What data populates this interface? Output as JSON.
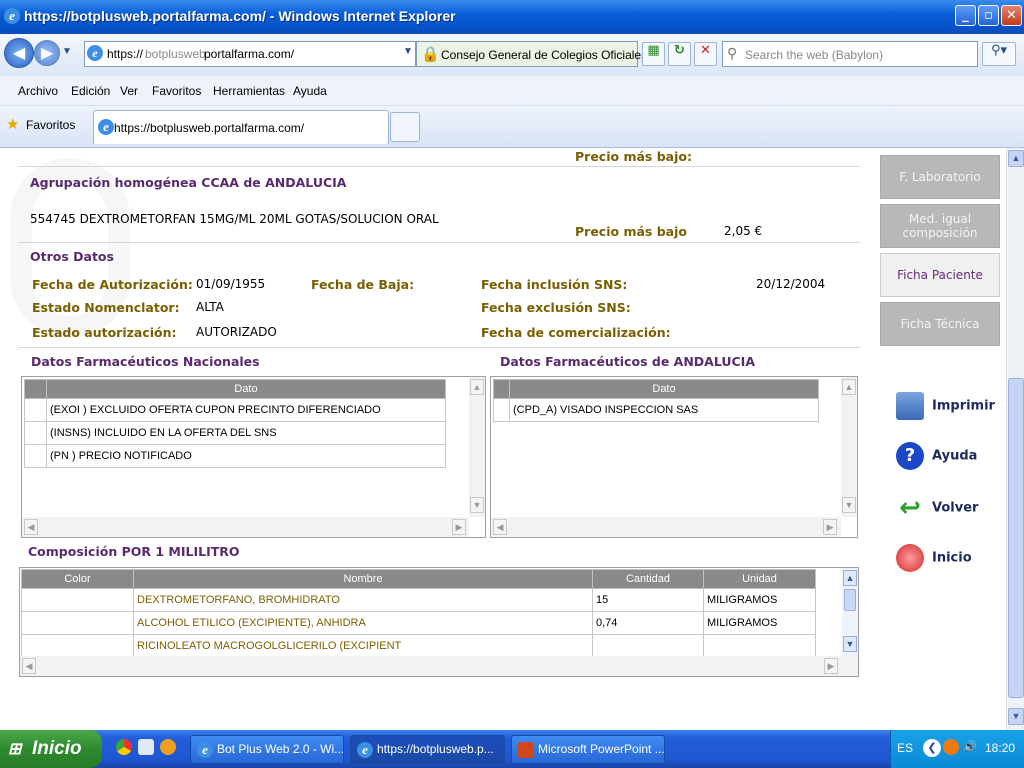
{
  "window": {
    "title": "https://botplusweb.portalfarma.com/ - Windows Internet Explorer",
    "minimize": "_",
    "maximize": "▫",
    "close": "✕"
  },
  "address_bar": {
    "prefix": "https://",
    "sub": "botplusweb.",
    "domain": "portalfarma.com/",
    "security_label": "Consejo General de Colegios Oficiales ...",
    "search_placeholder": "Search the web (Babylon)"
  },
  "menu": [
    "Archivo",
    "Edición",
    "Ver",
    "Favoritos",
    "Herramientas",
    "Ayuda"
  ],
  "favorites": {
    "label": "Favoritos",
    "tab_title": "https://botplusweb.portalfarma.com/"
  },
  "page": {
    "top_price_label": "Precio más bajo:",
    "agrupacion_title": "Agrupación homogénea CCAA de ANDALUCIA",
    "product_line": "554745  DEXTROMETORFAN 15MG/ML 20ML GOTAS/SOLUCION ORAL",
    "price_label": "Precio más bajo",
    "price_value": "2,05 €",
    "otros_title": "Otros Datos",
    "fecha_autorizacion_label": "Fecha de Autorización:",
    "fecha_autorizacion_value": "01/09/1955",
    "fecha_baja_label": "Fecha de Baja:",
    "fecha_inclusion_label": "Fecha inclusión SNS:",
    "fecha_inclusion_value": "20/12/2004",
    "estado_nomenclator_label": "Estado Nomenclator:",
    "estado_nomenclator_value": "ALTA",
    "fecha_exclusion_label": "Fecha exclusión SNS:",
    "estado_autorizacion_label": "Estado autorización:",
    "estado_autorizacion_value": "AUTORIZADO",
    "fecha_comercializacion_label": "Fecha de comercialización:",
    "nacionales_title": "Datos Farmacéuticos Nacionales",
    "andalucia_title": "Datos Farmacéuticos de ANDALUCIA",
    "dato_header": "Dato",
    "nacionales_rows": [
      "(EXOI ) EXCLUIDO OFERTA CUPON PRECINTO DIFERENCIADO",
      "(INSNS) INCLUIDO EN LA OFERTA DEL SNS",
      "(PN ) PRECIO NOTIFICADO"
    ],
    "andalucia_rows": [
      "(CPD_A) VISADO INSPECCION SAS"
    ],
    "composicion_title": "Composición POR 1 MILILITRO",
    "composicion_headers": [
      "Color",
      "Nombre",
      "Cantidad",
      "Unidad"
    ],
    "composicion_rows": [
      {
        "color": "",
        "nombre": "DEXTROMETORFANO, BROMHIDRATO",
        "cantidad": "15",
        "unidad": "MILIGRAMOS"
      },
      {
        "color": "",
        "nombre": "ALCOHOL ETILICO (EXCIPIENTE), ANHIDRA",
        "cantidad": "0,74",
        "unidad": "MILIGRAMOS"
      },
      {
        "color": "",
        "nombre": "RICINOLEATO MACROGOLGLICERILO (EXCIPIENT",
        "cantidad": "",
        "unidad": ""
      }
    ]
  },
  "sidebar": {
    "buttons": [
      "F. Laboratorio",
      "Med. igual composición",
      "Ficha Paciente",
      "Ficha Técnica"
    ],
    "actions": [
      "Imprimir",
      "Ayuda",
      "Volver",
      "Inicio"
    ]
  },
  "taskbar": {
    "start": "Inicio",
    "items": [
      "Bot Plus Web 2.0 - Wi...",
      "https://botplusweb.p...",
      "Microsoft PowerPoint ..."
    ],
    "lang": "ES",
    "clock": "18:20"
  }
}
